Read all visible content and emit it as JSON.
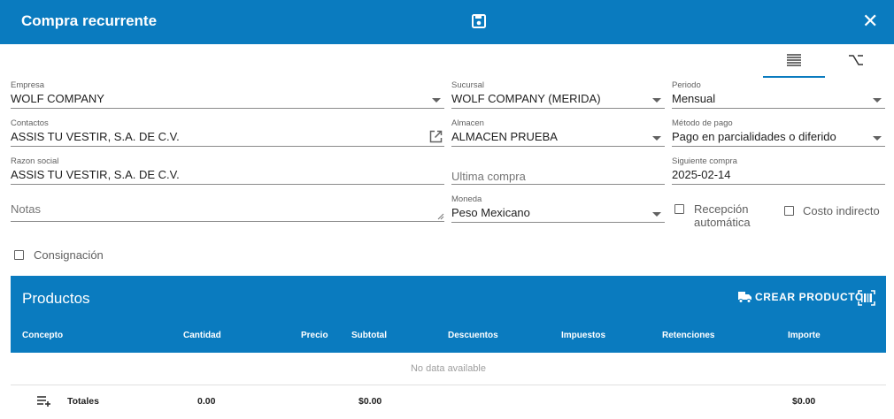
{
  "header": {
    "title": "Compra recurrente",
    "save_icon": "save-icon",
    "close_icon": "close-icon",
    "color": "#0a7bbf"
  },
  "view_tabs": [
    {
      "icon": "list-view-icon",
      "active": true
    },
    {
      "icon": "option-icon",
      "active": false
    }
  ],
  "form": {
    "empresa": {
      "label": "Empresa",
      "value": "WOLF COMPANY"
    },
    "sucursal": {
      "label": "Sucursal",
      "value": "WOLF COMPANY (MERIDA)"
    },
    "periodo": {
      "label": "Periodo",
      "value": "Mensual"
    },
    "contactos": {
      "label": "Contactos",
      "value": "ASSIS TU VESTIR, S.A. DE C.V."
    },
    "almacen": {
      "label": "Almacen",
      "value": "ALMACEN PRUEBA"
    },
    "metodo_pago": {
      "label": "Método de pago",
      "value": "Pago en parcialidades o diferido"
    },
    "razon_social": {
      "label": "Razon social",
      "value": "ASSIS TU VESTIR, S.A. DE C.V."
    },
    "ultima_compra": {
      "placeholder": "Ultima compra"
    },
    "siguiente_compra": {
      "label": "Siguiente compra",
      "value": "2025-02-14"
    },
    "notas": {
      "placeholder": "Notas"
    },
    "moneda": {
      "label": "Moneda",
      "value": "Peso Mexicano"
    },
    "recepcion_automatica": {
      "label_line1": "Recepción",
      "label_line2": "automática",
      "checked": false
    },
    "costo_indirecto": {
      "label": "Costo indirecto",
      "checked": false
    },
    "consignacion": {
      "label": "Consignación",
      "checked": false
    }
  },
  "productos": {
    "title": "Productos",
    "crear_label": "CREAR PRODUCTO",
    "columns": [
      "Concepto",
      "Cantidad",
      "Precio",
      "Subtotal",
      "Descuentos",
      "Impuestos",
      "Retenciones",
      "Importe"
    ],
    "empty_text": "No data available",
    "totals": {
      "label": "Totales",
      "cantidad": "0.00",
      "subtotal": "$0.00",
      "importe": "$0.00"
    }
  }
}
